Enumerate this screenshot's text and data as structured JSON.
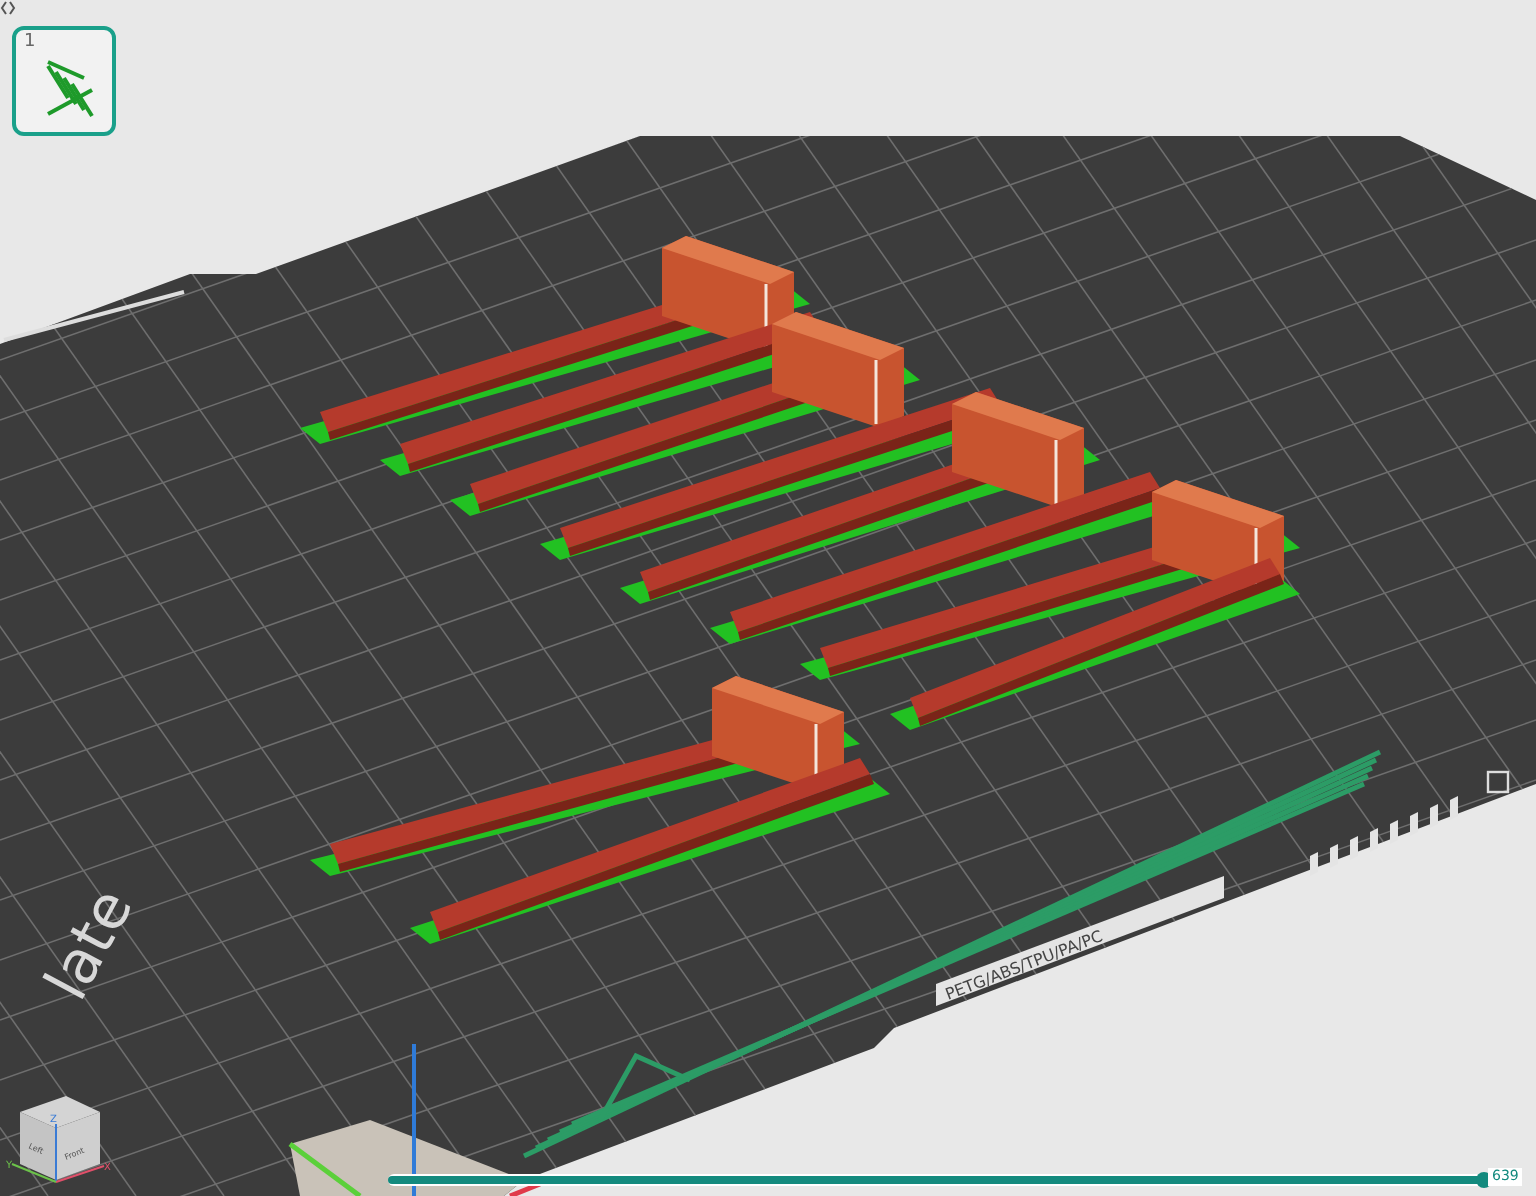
{
  "plate_thumbnail": {
    "number": "1",
    "selected": true
  },
  "bed": {
    "label": "late",
    "filament_label": "PETG/ABS/TPU/PA/PC"
  },
  "view_cube": {
    "top": "Z",
    "left_face": "Left",
    "front_face": "Front",
    "y_axis": "Y",
    "x_axis": "X"
  },
  "layer_slider": {
    "level": 1.0,
    "reading": "639"
  }
}
